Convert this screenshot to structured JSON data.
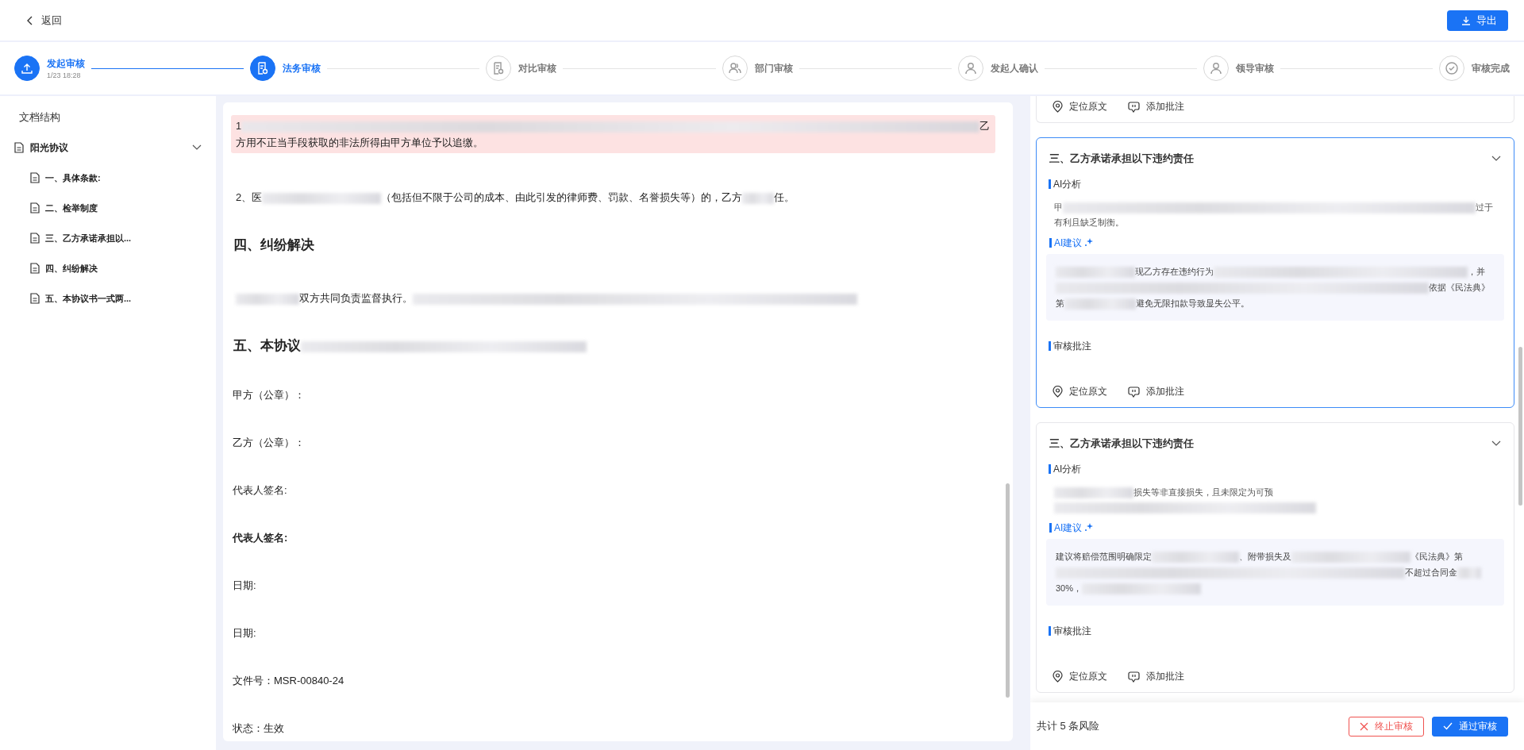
{
  "header": {
    "back": "返回",
    "export": "导出"
  },
  "steps": [
    {
      "label": "发起审核",
      "time": "1/23 18:28",
      "reached": true
    },
    {
      "label": "法务审核",
      "reached": true
    },
    {
      "label": "对比审核",
      "reached": false
    },
    {
      "label": "部门审核",
      "reached": false
    },
    {
      "label": "发起人确认",
      "reached": false
    },
    {
      "label": "领导审核",
      "reached": false
    },
    {
      "label": "审核完成",
      "reached": false
    }
  ],
  "sidebar": {
    "title": "文档结构",
    "tree": [
      {
        "label": "阳光协议",
        "expanded": true,
        "children": [
          {
            "label": "一、具体条款:"
          },
          {
            "label": "二、检举制度"
          },
          {
            "label": "三、乙方承诺承担以..."
          },
          {
            "label": "四、纠纷解决"
          },
          {
            "label": "五、本协议书一式两..."
          }
        ]
      }
    ]
  },
  "document": {
    "blocks": [
      {
        "kind": "para",
        "highlighted": true,
        "parts": [
          "1",
          "乙方用不正当手段获取的非法所得由甲方单位予以追缴。"
        ]
      },
      {
        "kind": "para",
        "highlighted": false,
        "parts": [
          "2、医",
          "（包括但不限于公司的成本、由此引发的律师费、罚款、名誉损失等）的，乙方",
          "任。"
        ]
      },
      {
        "kind": "heading",
        "parts": [
          "四、纠纷解决"
        ]
      },
      {
        "kind": "para",
        "highlighted": false,
        "parts": [
          "双方共同负责监督执行。"
        ]
      },
      {
        "kind": "heading",
        "parts": [
          "五、本协议"
        ]
      },
      {
        "kind": "field",
        "bold": false,
        "text": "甲方（公章）："
      },
      {
        "kind": "field",
        "bold": false,
        "text": "乙方（公章）："
      },
      {
        "kind": "field",
        "bold": false,
        "text": "代表人签名:"
      },
      {
        "kind": "field",
        "bold": true,
        "text": "代表人签名:"
      },
      {
        "kind": "field",
        "bold": false,
        "text": "日期:"
      },
      {
        "kind": "field",
        "bold": false,
        "text": "日期:"
      },
      {
        "kind": "field",
        "bold": false,
        "text": "文件号：MSR-00840-24"
      },
      {
        "kind": "field",
        "bold": false,
        "text": "状态：生效"
      }
    ]
  },
  "risks": {
    "cards": [
      {
        "kind": "clipped",
        "selected": false,
        "locate": "定位原文",
        "annotate": "添加批注"
      },
      {
        "kind": "full",
        "selected": true,
        "title": "三、乙方承诺承担以下违约责任",
        "analysis_label": "AI分析",
        "analysis": [
          "甲",
          "过于有利且缺乏制衡。"
        ],
        "suggestion_label": "AI建议",
        "suggestion": [
          "现乙方存在违约行为",
          "，并",
          "依据《民法典》第",
          "避免无限扣款导致显失公平。"
        ],
        "review_label": "审核批注",
        "locate": "定位原文",
        "annotate": "添加批注"
      },
      {
        "kind": "full",
        "selected": false,
        "title": "三、乙方承诺承担以下违约责任",
        "analysis_label": "AI分析",
        "analysis": [
          "损失等非直接损失，且未限定为可预"
        ],
        "suggestion_label": "AI建议",
        "suggestion": [
          "建议将赔偿范围明确限定",
          "、附带损失及",
          "《民法典》",
          "第",
          "不超过合同",
          "金",
          "30%，"
        ],
        "review_label": "审核批注",
        "locate": "定位原文",
        "annotate": "添加批注"
      }
    ],
    "total": "共计 5 条风险",
    "reject": "终止审核",
    "approve": "通过审核"
  }
}
